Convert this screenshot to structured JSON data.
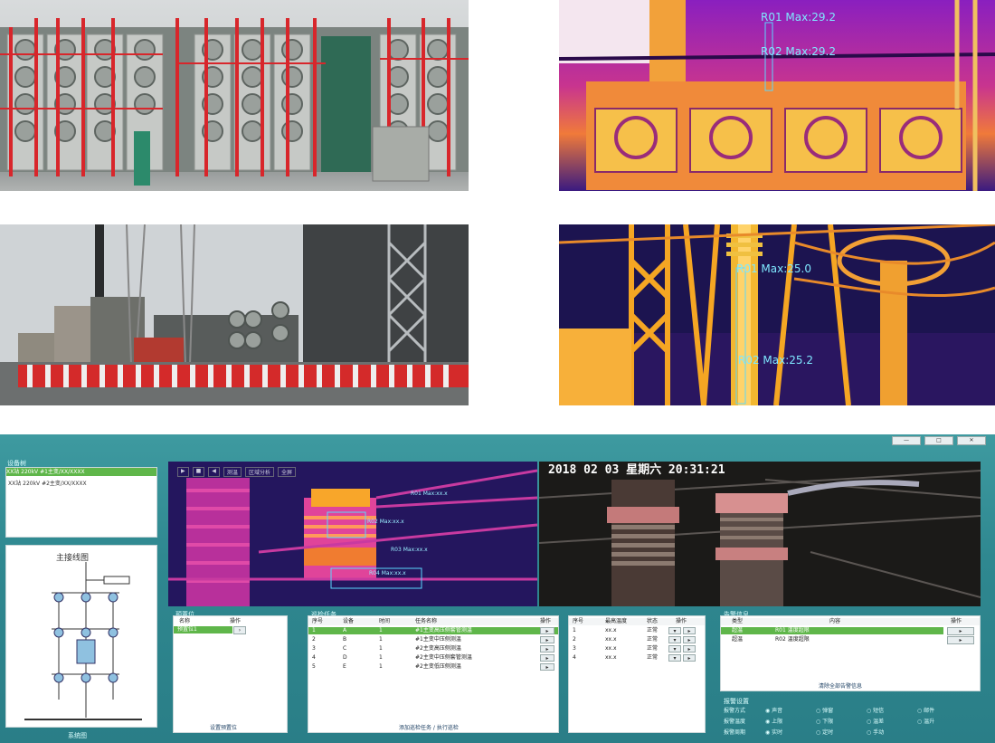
{
  "thermal_top": {
    "labels": [
      "R01 Max:29.2",
      "R02 Max:29.2"
    ]
  },
  "thermal_bottom": {
    "labels": [
      "R01 Max:25.0",
      "R02 Max:25.2"
    ]
  },
  "app": {
    "window_controls": [
      "—",
      "□",
      "✕"
    ],
    "device_panel": {
      "title": "设备树",
      "items": [
        "XX站 220kV #1主变/XX/XXXX",
        "XX站 220kV #2主变/XX/XXXX"
      ]
    },
    "diagram": {
      "title": "主接线图",
      "footer": "系统图"
    },
    "thermal_view": {
      "toolbar": [
        "▶",
        "■",
        "◀",
        "测温",
        "区域分析",
        "全屏"
      ],
      "labels": [
        "R01 Max:xx.x",
        "R02 Max:xx.x",
        "R03 Max:xx.x",
        "R04 Max:xx.x"
      ]
    },
    "visible_view": {
      "timestamp": "2018 02 03  星期六  20:31:21"
    },
    "preset_panel": {
      "title": "预置位",
      "header": [
        "名称",
        "操作"
      ],
      "rows": [
        "预置位1"
      ],
      "footer": "设置预置位"
    },
    "task_panel": {
      "title": "巡检任务",
      "headers": [
        "序号",
        "设备",
        "时间",
        "任务名称",
        "操作"
      ],
      "rows": [
        {
          "n": "1",
          "dev": "A",
          "t": "1",
          "name": "#1主变高压侧套管测温"
        },
        {
          "n": "2",
          "dev": "B",
          "t": "1",
          "name": "#1主变中压侧测温"
        },
        {
          "n": "3",
          "dev": "C",
          "t": "1",
          "name": "#2主变高压侧测温"
        },
        {
          "n": "4",
          "dev": "D",
          "t": "1",
          "name": "#2主变中压侧套管测温"
        },
        {
          "n": "5",
          "dev": "E",
          "t": "1",
          "name": "#2主变低压侧测温"
        }
      ],
      "footer": "添加巡检任务 / 执行巡检"
    },
    "temp_panel": {
      "headers": [
        "序号",
        "最高温度",
        "状态",
        "操作"
      ],
      "rows": [
        {
          "n": "1",
          "v": "xx.x",
          "s": "正常"
        },
        {
          "n": "2",
          "v": "xx.x",
          "s": "正常"
        },
        {
          "n": "3",
          "v": "xx.x",
          "s": "正常"
        },
        {
          "n": "4",
          "v": "xx.x",
          "s": "正常"
        }
      ]
    },
    "alarm_panel": {
      "title": "告警信息",
      "headers": [
        "类型",
        "内容",
        "操作"
      ],
      "rows": [
        {
          "type": "超温",
          "text": "R01 温度超限"
        },
        {
          "type": "超温",
          "text": "R02 温度超限"
        }
      ],
      "footer": "清除全部告警信息"
    },
    "settings_panel": {
      "title": "报警设置",
      "rows": [
        {
          "label": "报警方式",
          "options": [
            "声音",
            "弹窗",
            "短信",
            "邮件"
          ]
        },
        {
          "label": "报警温度",
          "options": [
            "上限",
            "下限",
            "温差",
            "温升"
          ]
        },
        {
          "label": "报警周期",
          "options": [
            "实时",
            "定时",
            "手动"
          ]
        }
      ]
    }
  }
}
